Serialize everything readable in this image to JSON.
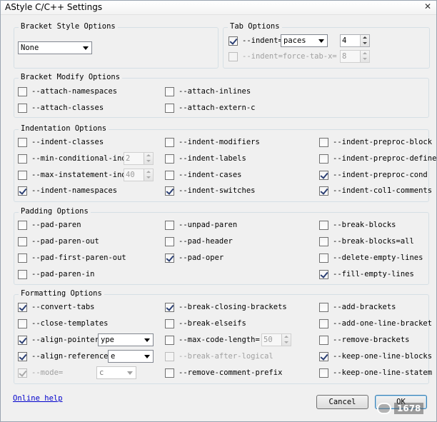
{
  "window": {
    "title": "AStyle C/C++ Settings"
  },
  "icons": {
    "close": "close-icon",
    "dropdown": "chevron-down-icon",
    "spinner": "spinner-arrows-icon"
  },
  "groups": {
    "bracket_style": "Bracket Style Options",
    "tab": "Tab Options",
    "bracket_modify": "Bracket Modify Options",
    "indentation": "Indentation Options",
    "padding": "Padding Options",
    "formatting": "Formatting Options"
  },
  "bracket_style": {
    "value": "None"
  },
  "tab": {
    "indent_label": "--indent=",
    "indent_select": "paces",
    "indent_value": "4",
    "force_tab_label": "--indent=force-tab-x=",
    "force_tab_value": "8"
  },
  "bracket_modify": {
    "attach_namespaces": "--attach-namespaces",
    "attach_inlines": "--attach-inlines",
    "attach_classes": "--attach-classes",
    "attach_extern_c": "--attach-extern-c"
  },
  "indentation": {
    "indent_classes": "--indent-classes",
    "indent_modifiers": "--indent-modifiers",
    "indent_preproc_block": "--indent-preproc-block",
    "min_conditional": "--min-conditional-inde",
    "min_conditional_value": "2",
    "indent_labels": "--indent-labels",
    "indent_preproc_define": "--indent-preproc-define",
    "max_instatement": "--max-instatement-inde",
    "max_instatement_value": "40",
    "indent_cases": "--indent-cases",
    "indent_preproc_cond": "--indent-preproc-cond",
    "indent_namespaces": "--indent-namespaces",
    "indent_switches": "--indent-switches",
    "indent_col1_comments": "--indent-col1-comments"
  },
  "padding": {
    "pad_paren": "--pad-paren",
    "unpad_paren": "--unpad-paren",
    "break_blocks": "--break-blocks",
    "pad_paren_out": "--pad-paren-out",
    "pad_header": "--pad-header",
    "break_blocks_all": "--break-blocks=all",
    "pad_first_paren_out": "--pad-first-paren-out",
    "pad_oper": "--pad-oper",
    "delete_empty_lines": "--delete-empty-lines",
    "pad_paren_in": "--pad-paren-in",
    "fill_empty_lines": "--fill-empty-lines"
  },
  "formatting": {
    "convert_tabs": "--convert-tabs",
    "break_closing_brackets": "--break-closing-brackets",
    "add_brackets": "--add-brackets",
    "close_templates": "--close-templates",
    "break_elseifs": "--break-elseifs",
    "add_one_line_bracket": "--add-one-line-bracket",
    "align_pointer": "--align-pointer=",
    "align_pointer_value": "ype",
    "max_code_length": "--max-code-length=",
    "max_code_length_value": "50",
    "remove_brackets": "--remove-brackets",
    "align_reference": "--align-reference=",
    "align_reference_value": "e",
    "break_after_logical": "--break-after-logical",
    "keep_one_line_blocks": "--keep-one-line-blocks",
    "mode": "--mode=",
    "mode_value": "c",
    "remove_comment_prefix": "--remove-comment-prefix",
    "keep_one_line_statem": "--keep-one-line-statem"
  },
  "footer": {
    "online_help": "Online help",
    "cancel": "Cancel",
    "ok": "OK"
  },
  "watermark": "1678"
}
